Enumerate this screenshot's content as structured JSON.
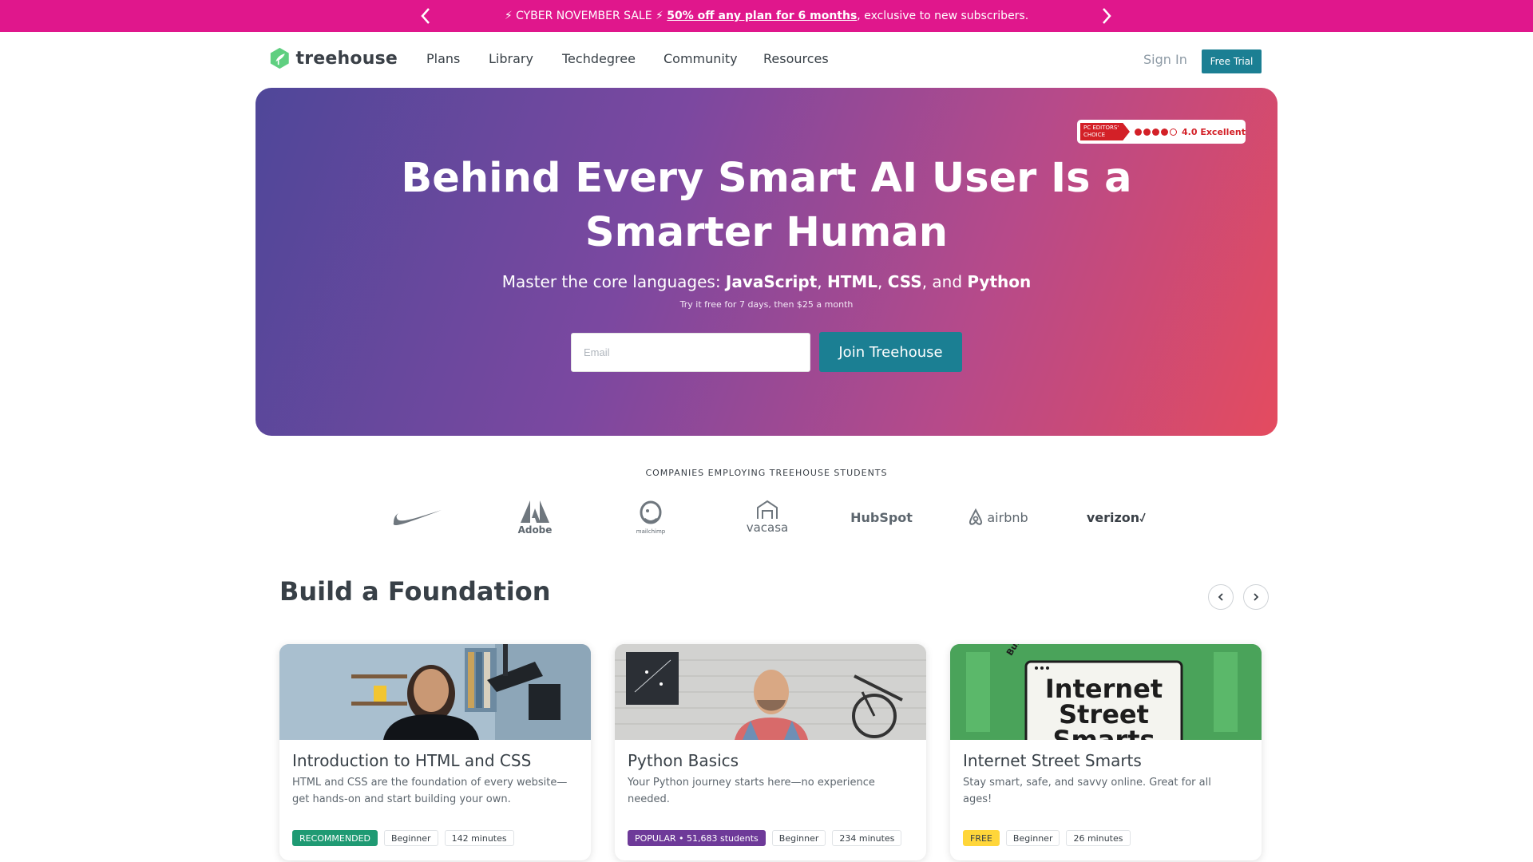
{
  "promo": {
    "prefix": "⚡ CYBER NOVEMBER SALE ⚡ ",
    "link": "50% off any plan for 6 months",
    "suffix": ", exclusive to new subscribers."
  },
  "header": {
    "brand": "treehouse",
    "nav": [
      "Plans",
      "Library",
      "Techdegree",
      "Community",
      "Resources"
    ],
    "sign_in": "Sign In",
    "free_trial": "Free Trial"
  },
  "hero": {
    "badge_ribbon": "PC EDITORS' CHOICE",
    "badge_rating": "4.0 Excellent",
    "badge_stars_filled": 4,
    "badge_stars_total": 5,
    "title": "Behind Every Smart AI User Is a Smarter Human",
    "sub_prefix": "Master the core languages: ",
    "lang_js": "JavaScript",
    "sep1": ", ",
    "lang_html": "HTML",
    "sep2": ", ",
    "lang_css": "CSS",
    "sep3": ", and ",
    "lang_py": "Python",
    "note": "Try it free for 7 days, then $25 a month",
    "email_placeholder": "Email",
    "join_label": "Join Treehouse"
  },
  "companies": {
    "label": "COMPANIES EMPLOYING TREEHOUSE STUDENTS",
    "logos": [
      "nike",
      "Adobe",
      "mailchimp",
      "vacasa",
      "HubSpot",
      "airbnb",
      "verizon"
    ]
  },
  "section": {
    "title": "Build a Foundation"
  },
  "cards": [
    {
      "title": "Introduction to HTML and CSS",
      "desc": "HTML and CSS are the foundation of every website—get hands-on and start building your own.",
      "badge": "RECOMMENDED",
      "level": "Beginner",
      "duration": "142 minutes"
    },
    {
      "title": "Python Basics",
      "desc": "Your Python journey starts here—no experience needed.",
      "badge": "POPULAR • 51,683 students",
      "level": "Beginner",
      "duration": "234 minutes"
    },
    {
      "title": "Internet Street Smarts",
      "desc": "Stay smart, safe, and savvy online. Great for all ages!",
      "badge": "FREE",
      "level": "Beginner",
      "duration": "26 minutes",
      "image_text_top": "Internet",
      "image_text_mid": "Street",
      "image_text_bot": "Smarts",
      "image_sticker": "Build your"
    }
  ],
  "colors": {
    "promo_bg": "#e0178c",
    "accent_teal": "#1b7f93",
    "brand_green": "#5fcf80",
    "badge_red": "#d32027"
  }
}
